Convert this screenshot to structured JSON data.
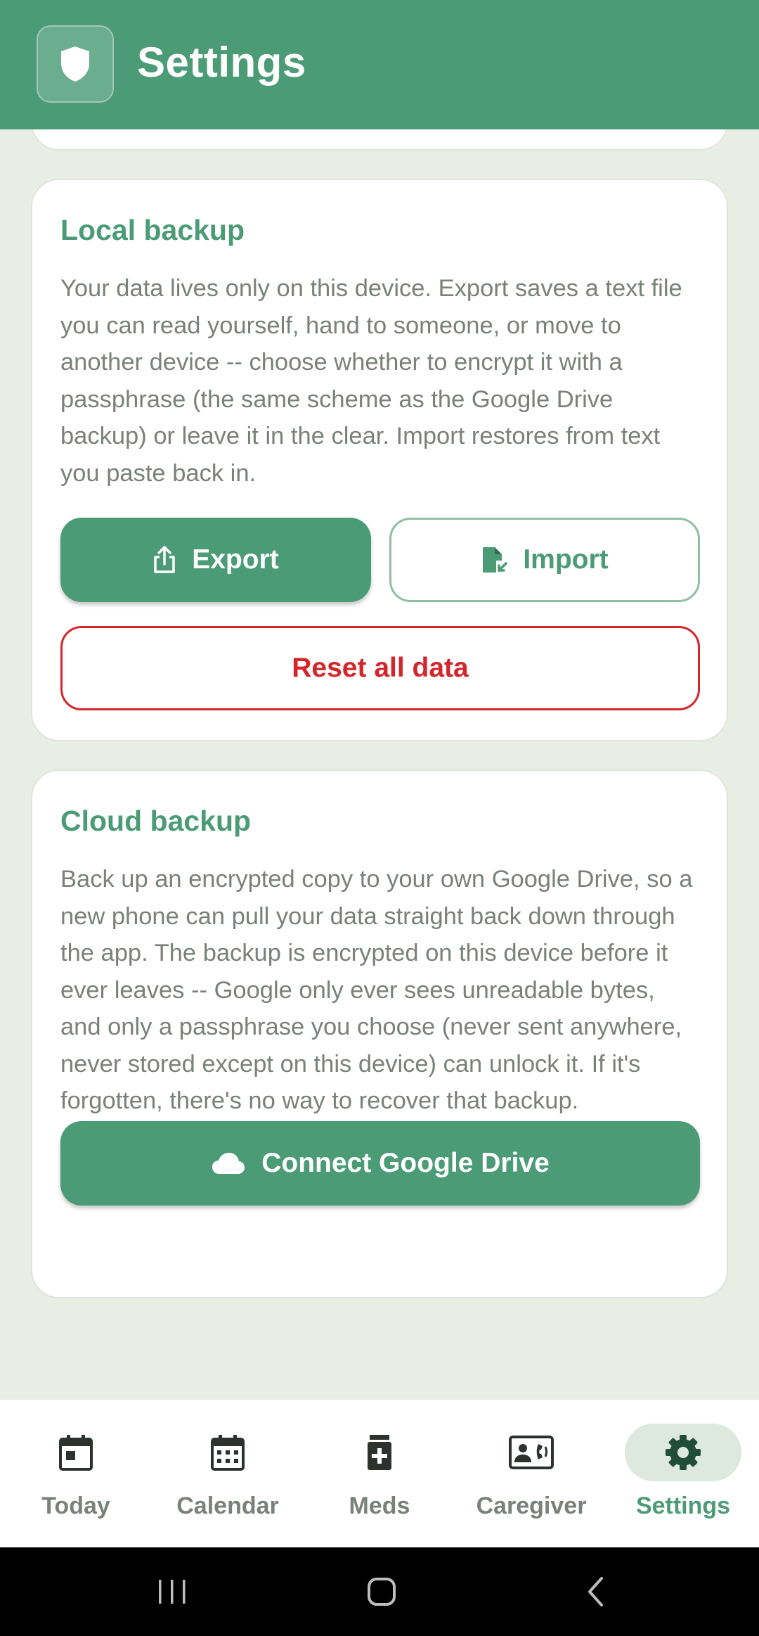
{
  "header": {
    "title": "Settings",
    "logo_icon": "shield-icon"
  },
  "colors": {
    "primary": "#4b9b77",
    "danger": "#d3262b",
    "background": "#e9eee4",
    "muted_text": "#7a807a"
  },
  "local_backup": {
    "title": "Local backup",
    "description": "Your data lives only on this device. Export saves a text file you can read yourself, hand to someone, or move to another device -- choose whether to encrypt it with a passphrase (the same scheme as the Google Drive backup) or leave it in the clear. Import restores from text you paste back in.",
    "export_label": "Export",
    "export_icon": "share-upload-icon",
    "import_label": "Import",
    "import_icon": "file-import-icon",
    "reset_label": "Reset all data"
  },
  "cloud_backup": {
    "title": "Cloud backup",
    "description": "Back up an encrypted copy to your own Google Drive, so a new phone can pull your data straight back down through the app. The backup is encrypted on this device before it ever leaves -- Google only ever sees unreadable bytes, and only a passphrase you choose (never sent anywhere, never stored except on this device) can unlock it. If it's forgotten, there's no way to recover that backup.",
    "connect_label": "Connect Google Drive",
    "connect_icon": "cloud-icon"
  },
  "bottom_nav": {
    "items": [
      {
        "label": "Today",
        "icon": "calendar-today-icon",
        "active": false
      },
      {
        "label": "Calendar",
        "icon": "calendar-month-icon",
        "active": false
      },
      {
        "label": "Meds",
        "icon": "medication-icon",
        "active": false
      },
      {
        "label": "Caregiver",
        "icon": "contact-phone-icon",
        "active": false
      },
      {
        "label": "Settings",
        "icon": "gear-icon",
        "active": true
      }
    ]
  },
  "system_nav": {
    "recents": "recents-icon",
    "home": "home-icon",
    "back": "back-icon"
  }
}
